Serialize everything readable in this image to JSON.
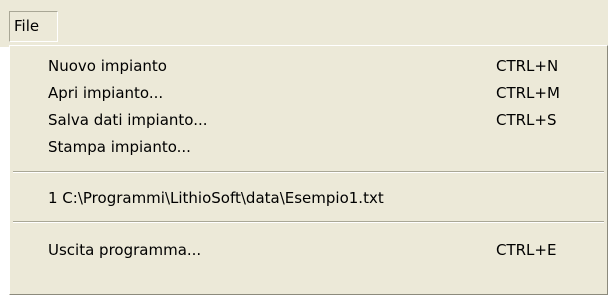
{
  "menubar": {
    "title": "File"
  },
  "menu": {
    "items": [
      {
        "label": "Nuovo impianto",
        "shortcut": "CTRL+N"
      },
      {
        "label": "Apri impianto...",
        "shortcut": "CTRL+M"
      },
      {
        "label": "Salva dati impianto...",
        "shortcut": "CTRL+S"
      },
      {
        "label": "Stampa impianto..."
      }
    ],
    "recent_files": [
      {
        "label": "1 C:\\Programmi\\LithioSoft\\data\\Esempio1.txt"
      }
    ],
    "exit": {
      "label": "Uscita programma...",
      "shortcut": "CTRL+E"
    }
  },
  "colors": {
    "menu_background": "#ece9d8",
    "text": "#000000",
    "separator_shadow": "#a9a796",
    "separator_highlight": "#ffffff"
  }
}
